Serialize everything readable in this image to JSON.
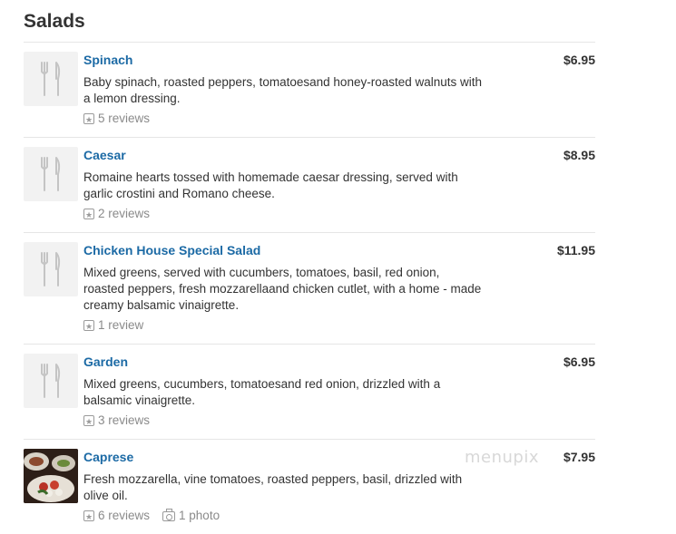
{
  "section": {
    "title": "Salads"
  },
  "items": [
    {
      "name": "Spinach",
      "price": "$6.95",
      "description": "Baby spinach, roasted peppers, tomatoesand honey-roasted walnuts with a lemon dressing.",
      "reviews": "5 reviews",
      "icon": "utensils-icon"
    },
    {
      "name": "Caesar",
      "price": "$8.95",
      "description": "Romaine hearts tossed with homemade caesar dressing, served with garlic crostini and Romano cheese.",
      "reviews": "2 reviews",
      "icon": "utensils-icon"
    },
    {
      "name": "Chicken House Special Salad",
      "price": "$11.95",
      "description": "Mixed greens, served with cucumbers, tomatoes, basil, red onion, roasted peppers, fresh mozzarellaand chicken cutlet, with a home - made creamy balsamic vinaigrette.",
      "reviews": "1 review",
      "icon": "utensils-icon"
    },
    {
      "name": "Garden",
      "price": "$6.95",
      "description": "Mixed greens, cucumbers, tomatoesand red onion, drizzled with a balsamic vinaigrette.",
      "reviews": "3 reviews",
      "icon": "utensils-icon"
    },
    {
      "name": "Caprese",
      "price": "$7.95",
      "description": "Fresh mozzarella, vine tomatoes, roasted peppers, basil, drizzled with olive oil.",
      "reviews": "6 reviews",
      "photos": "1 photo",
      "icon": "food-photo"
    }
  ],
  "watermark": "menupix",
  "colors": {
    "link": "#1c6aa5",
    "text": "#333333",
    "muted": "#8a8a8a"
  }
}
